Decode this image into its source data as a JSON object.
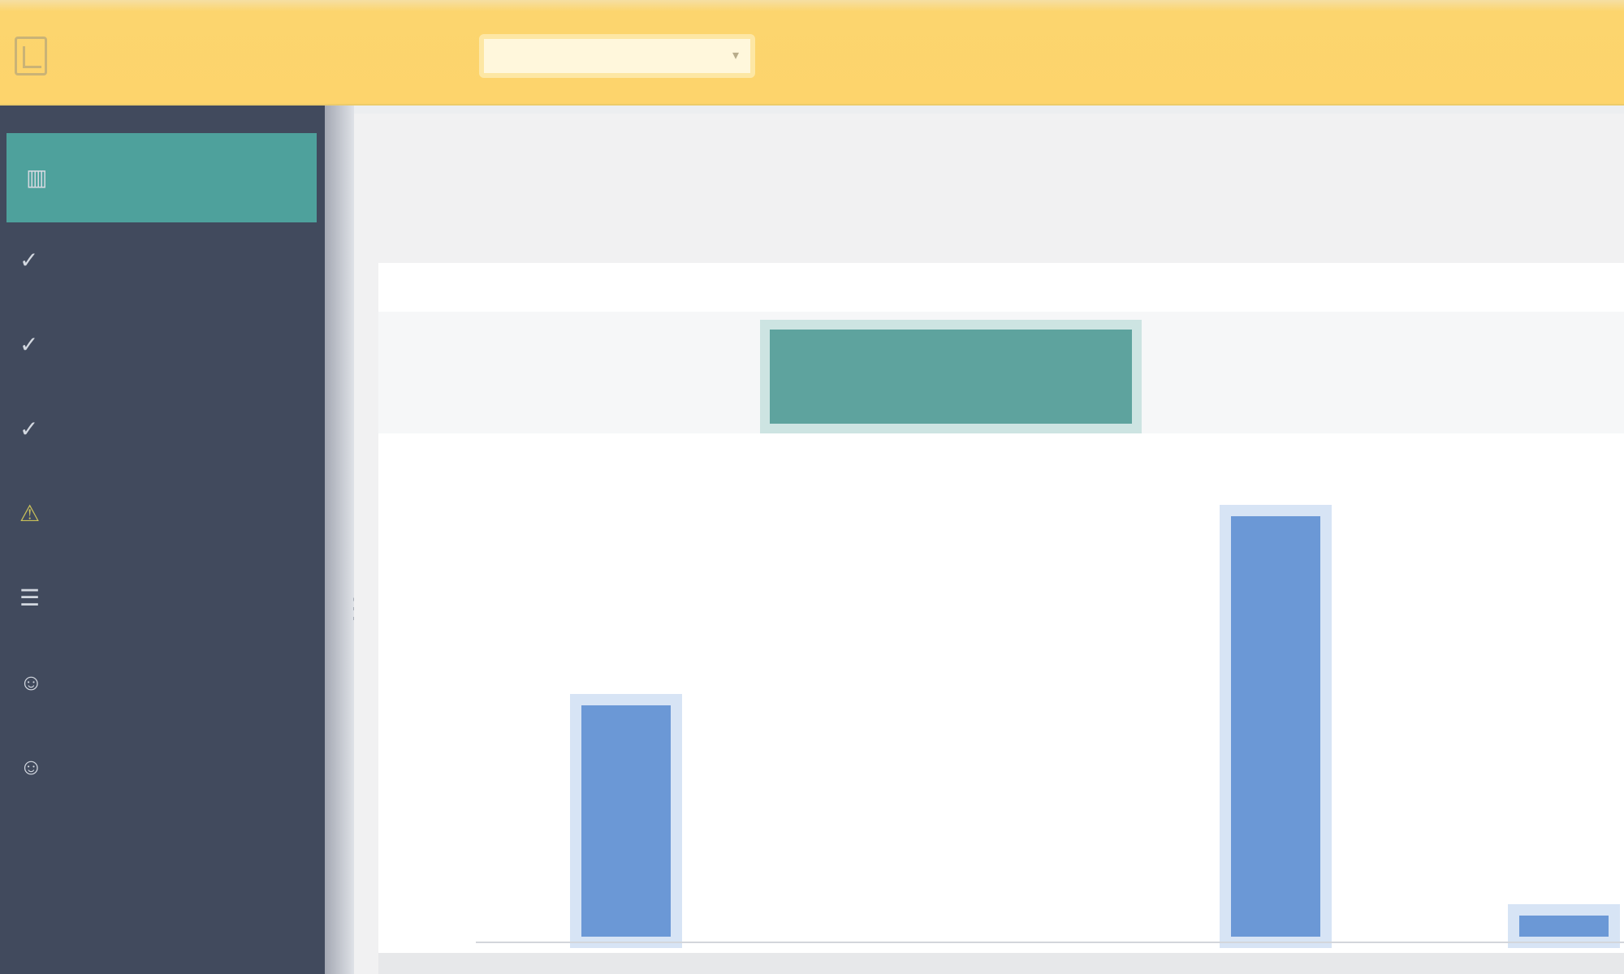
{
  "app": {
    "logo_line1": "",
    "logo_line2": "",
    "top_links": [
      "",
      ""
    ],
    "search_placeholder": ""
  },
  "sidebar": {
    "items": [
      {
        "label": "",
        "icon": "chart-icon",
        "active": true
      },
      {
        "label": "",
        "icon": "check-icon"
      },
      {
        "label": "",
        "icon": "check-icon"
      },
      {
        "label": "",
        "icon": "check-icon"
      },
      {
        "label": "",
        "icon": "warning-icon",
        "warn": true
      },
      {
        "label": "",
        "icon": "list-icon"
      },
      {
        "label": "",
        "icon": "user-icon",
        "warn": true
      },
      {
        "label": "",
        "icon": "user-check-icon"
      }
    ]
  },
  "main": {
    "title": "",
    "subtitle": "",
    "y_caption": "",
    "columns": [
      "",
      "",
      "",
      ""
    ]
  },
  "colors": {
    "accent_teal": "#4ea19c",
    "bar_blue": "#6b98d6",
    "topbar_yellow": "#fdd46c",
    "sidebar_navy": "#414a5d"
  },
  "chart_data": {
    "type": "bar",
    "categories": [
      "",
      "",
      "",
      ""
    ],
    "values": [
      55,
      0,
      100,
      5
    ],
    "ylim": [
      0,
      112
    ],
    "yticks": [],
    "grid": false
  }
}
